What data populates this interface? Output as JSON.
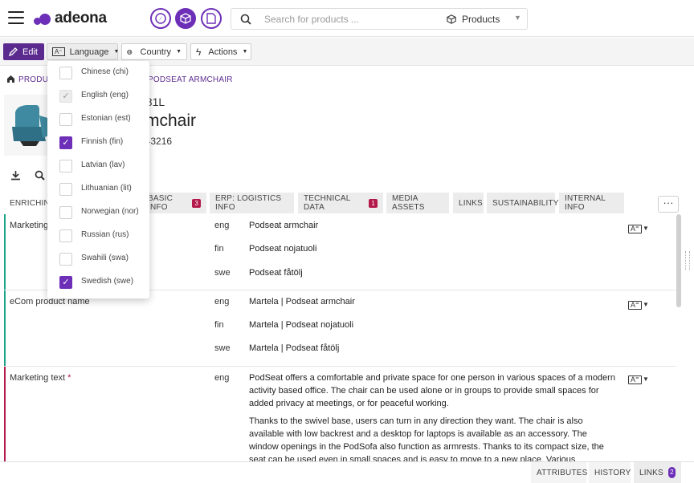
{
  "app": {
    "logo_text": "adeona"
  },
  "search": {
    "placeholder": "Search for products ...",
    "scope": "Products"
  },
  "toolbar": {
    "edit": "Edit",
    "language": "Language",
    "country": "Country",
    "actions": "Actions"
  },
  "breadcrumb": {
    "root": "PRODUCTS",
    "current": "PODSEAT ARMCHAIR"
  },
  "product": {
    "code_tail": "981L",
    "name_tail": "rmchair",
    "ean_tail": "543216"
  },
  "tabs": [
    {
      "label": "ENRICHING"
    },
    {
      "label": "BASIC INFO",
      "badge": "3"
    },
    {
      "label": "ERP: LOGISTICS INFO"
    },
    {
      "label": "TECHNICAL DATA",
      "badge": "1"
    },
    {
      "label": "MEDIA ASSETS"
    },
    {
      "label": "LINKS"
    },
    {
      "label": "SUSTAINABILITY"
    },
    {
      "label": "INTERNAL INFO"
    }
  ],
  "more_label": "···",
  "fields": [
    {
      "label": "Marketing",
      "bar_color": "#1aa38a",
      "rows": [
        {
          "lang": "eng",
          "value": "Podseat armchair"
        },
        {
          "lang": "fin",
          "value": "Podseat nojatuoli"
        },
        {
          "lang": "swe",
          "value": "Podseat fåtölj"
        }
      ]
    },
    {
      "label": "eCom product name",
      "bar_color": "#1aa38a",
      "rows": [
        {
          "lang": "eng",
          "value": "Martela | Podseat armchair"
        },
        {
          "lang": "fin",
          "value": "Martela | Podseat nojatuoli"
        },
        {
          "lang": "swe",
          "value": "Martela | Podseat fåtölj"
        }
      ]
    },
    {
      "label": "Marketing text",
      "required": "*",
      "bar_color": "#b31a4a",
      "lang": "eng",
      "p1": "PodSeat offers a comfortable and private space for one person in various spaces of a modern activity based office. The chair can be used alone or in groups to provide small spaces for added privacy at meetings, or for peaceful working.",
      "p2": "Thanks to the swivel base, users can turn in any direction they want. The chair is also available with low backrest and a desktop for laptops is available as an accessory. The window openings in the PodSofa also function as armrests. Thanks to its compact size, the seat can be used even in small spaces and is easy to move to a new place. Various upholstery materials can be used to"
    }
  ],
  "language_menu": [
    {
      "label": "Chinese (chi)",
      "state": "unchecked"
    },
    {
      "label": "English (eng)",
      "state": "disabled"
    },
    {
      "label": "Estonian (est)",
      "state": "unchecked"
    },
    {
      "label": "Finnish (fin)",
      "state": "checked"
    },
    {
      "label": "Latvian (lav)",
      "state": "unchecked"
    },
    {
      "label": "Lithuanian (lit)",
      "state": "unchecked"
    },
    {
      "label": "Norwegian (nor)",
      "state": "unchecked"
    },
    {
      "label": "Russian (rus)",
      "state": "unchecked"
    },
    {
      "label": "Swahili (swa)",
      "state": "unchecked"
    },
    {
      "label": "Swedish (swe)",
      "state": "checked"
    }
  ],
  "bottom_tabs": [
    {
      "label": "ATTRIBUTES"
    },
    {
      "label": "HISTORY"
    },
    {
      "label": "LINKS",
      "count": "2"
    }
  ],
  "colors": {
    "brand": "#6d2fb8",
    "edit": "#5b2a8e",
    "badge": "#b31a4a",
    "teal": "#1aa38a"
  }
}
